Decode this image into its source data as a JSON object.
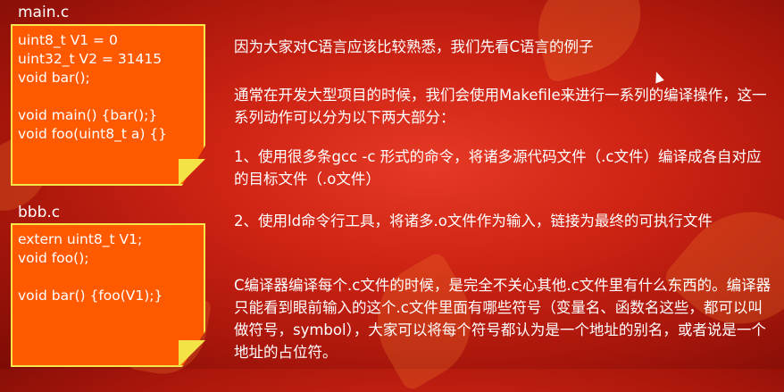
{
  "files": [
    {
      "label": "main.c",
      "lines": [
        "uint8_t V1 = 0",
        "uint32_t V2 = 31415",
        "void bar();",
        "",
        "void main() {bar();}",
        "void foo(uint8_t a) {}"
      ]
    },
    {
      "label": "bbb.c",
      "lines": [
        "extern uint8_t V1;",
        "void foo();",
        "",
        "void bar() {foo(V1);}"
      ]
    }
  ],
  "paragraphs": [
    "因为大家对C语言应该比较熟悉，我们先看C语言的例子",
    "通常在开发大型项目的时候，我们会使用Makefile来进行一系列的编译操作，这一系列动作可以分为以下两大部分：",
    "1、使用很多条gcc -c 形式的命令，将诸多源代码文件（.c文件）编译成各自对应的目标文件（.o文件）",
    "2、使用ld命令行工具，将诸多.o文件作为输入，链接为最终的可执行文件",
    "C编译器编译每个.c文件的时候，是完全不关心其他.c文件里有什么东西的。编译器只能看到眼前输入的这个.c文件里面有哪些符号（变量名、函数名这些，都可以叫做符号，symbol），大家可以将每个符号都认为是一个地址的别名，或者说是一个地址的占位符。"
  ],
  "colors": {
    "note_fill": "#ff5a00",
    "note_border": "#f7e64a",
    "background": "#cf2414"
  }
}
